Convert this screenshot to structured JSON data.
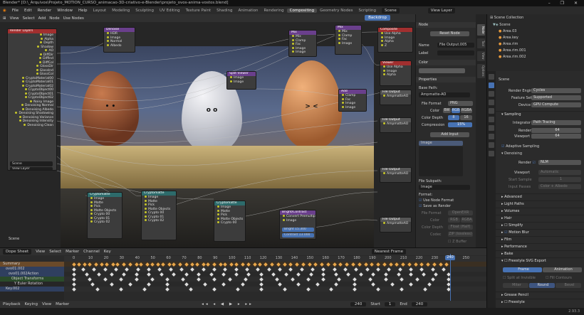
{
  "window": {
    "title": "Blender* [D:\\_Arquivos\\Projeto_MOTION_CURSO_animacao-3D-criativo-e-Blender\\projeto_ovos-anima-vostos.blend]",
    "controls": "– ❐ ✕"
  },
  "menubar": {
    "items": [
      "File",
      "Edit",
      "Render",
      "Window",
      "Help"
    ],
    "workspaces": [
      "Layout",
      "Modeling",
      "Sculpting",
      "UV Editing",
      "Texture Paint",
      "Shading",
      "Animation",
      "Rendering",
      "Compositing",
      "Geometry Nodes",
      "Scripting"
    ],
    "active_workspace": "Compositing",
    "scene": "Scene",
    "view_layer": "View Layer"
  },
  "node_editor": {
    "header": [
      "View",
      "Select",
      "Add",
      "Node",
      "Use Nodes"
    ],
    "backdrop_label": "Backdrop",
    "faces": [
      "• •",
      "o o",
      "> <"
    ],
    "nodes": {
      "render_layers": {
        "title": "Render Layers",
        "sockets": [
          "Image",
          "Alpha",
          "Depth",
          "Shadow",
          "AO",
          "DiffDir",
          "DiffInd",
          "DiffCol",
          "GlossDir",
          "GlossInd",
          "GlossCol",
          "CryptoMaterial00",
          "CryptoMaterial01",
          "CryptoMaterial02",
          "CryptoObject00",
          "CryptoObject01",
          "CryptoObject02",
          "Noisy Image",
          "Denoising Normal",
          "Denoising Albedo",
          "Denoising Shadowing",
          "Denoising Variance",
          "Denoising Intensity",
          "Denoising Clean"
        ],
        "scene": "Scene",
        "layer": "View Layer"
      },
      "denoise": {
        "title": "Denoise",
        "sockets": [
          "HDR",
          "Image",
          "Normal",
          "Albedo"
        ]
      },
      "composite": {
        "title": "Composite",
        "sockets": [
          "Use Alpha",
          "Image",
          "Alpha",
          "Z"
        ]
      },
      "viewer": {
        "title": "Viewer",
        "sockets": [
          "Use Alpha",
          "Image",
          "Alpha",
          "Z"
        ]
      },
      "mix1": {
        "title": "Mix",
        "sockets": [
          "Mix",
          "Clamp",
          "Fac",
          "Image",
          "Image"
        ]
      },
      "mix2": {
        "title": "Mix",
        "sockets": [
          "Mix",
          "Clamp",
          "Fac",
          "Image",
          "Image"
        ]
      },
      "split": {
        "title": "Split Viewer",
        "sockets": [
          "Image",
          "Image"
        ]
      },
      "add": {
        "title": "Add",
        "sockets": [
          "Clamp",
          "Fac",
          "Image",
          "Image"
        ]
      },
      "file_output_1": {
        "title": "File Output",
        "sockets": [
          "Image",
          "AmpmatteAO"
        ]
      },
      "file_output_2": {
        "title": "File Output",
        "sockets": [
          "Image",
          "AmpmatteAO"
        ]
      },
      "file_output_3": {
        "title": "File Output",
        "sockets": [
          "Image",
          "AmpmatteAO"
        ]
      },
      "file_output_4": {
        "title": "File Output",
        "sockets": [
          "Image",
          "AmpmatteAO"
        ]
      },
      "crypto1": {
        "title": "Cryptomatte",
        "sockets": [
          "Image",
          "Matte",
          "Pick",
          "Matte Objects",
          "Crypto 00",
          "Crypto 01",
          "Crypto 02"
        ]
      },
      "crypto2": {
        "title": "Cryptomatte",
        "sockets": [
          "Image",
          "Matte",
          "Pick",
          "Matte Objects",
          "Crypto 00",
          "Crypto 01",
          "Crypto 02"
        ]
      },
      "crypto3": {
        "title": "Cryptomatte",
        "sockets": [
          "Image",
          "Matte",
          "Pick",
          "Matte Objects",
          "Crypto 00",
          "Crypto 01"
        ]
      },
      "bright": {
        "title": "Bright/Contrast",
        "sockets": [
          "Image",
          "Bright",
          "Contrast"
        ],
        "bright": "15.300",
        "contrast": "13.000"
      },
      "convert": {
        "title": "Convert Premultiplied"
      }
    }
  },
  "npanel": {
    "tabs": [
      "Node",
      "Tool",
      "View",
      "Options"
    ],
    "node_section": "Node",
    "reset_node": "Reset Node",
    "name_label": "Name",
    "name_value": "File Output.005",
    "label_label": "Label",
    "color_section": "Color",
    "properties_section": "Properties",
    "base_path_label": "Base Path:",
    "base_path_value": "Ampmatte-AO",
    "file_format_label": "File Format",
    "file_format_value": "PNG",
    "color_label": "Color",
    "color_opts": [
      "BW",
      "RGB",
      "RGBA"
    ],
    "color_depth_label": "Color Depth",
    "color_depth_opts": [
      "8",
      "16"
    ],
    "compression_label": "Compression",
    "compression_value": "15%",
    "add_input": "Add Input",
    "input_item": "Image",
    "file_subpath_label": "File Subpath:",
    "file_subpath_value": "Image",
    "format_label": "Format:",
    "use_node_format": "Use Node Format",
    "save_as_render": "Save as Render",
    "file_format2_label": "File Format",
    "file_format2_value": "OpenEXR",
    "color2_label": "Color",
    "color2_opts": [
      "RGB",
      "RGBA"
    ],
    "color_depth2_label": "Color Depth",
    "color_depth2_value": "Float (Half)",
    "codec_label": "Codec",
    "codec_value": "ZIP (lossless)",
    "zbuffer": "Z Buffer"
  },
  "outliner": {
    "header": "Scene Collection",
    "rows": [
      "Scene",
      "Area.03",
      "Area.key",
      "Area.rim",
      "Area.rim.001",
      "Area.rim.002"
    ]
  },
  "properties": {
    "scene_label": "Scene",
    "render_engine_label": "Render Engine",
    "render_engine_value": "Cycles",
    "feature_set_label": "Feature Set",
    "feature_set_value": "Supported",
    "device_label": "Device",
    "device_value": "GPU Compute",
    "sampling_section": "Sampling",
    "integrator_label": "Integrator",
    "integrator_value": "Path Tracing",
    "render_label": "Render",
    "render_value": "64",
    "viewport_label": "Viewport",
    "viewport_value": "64",
    "adaptive_sampling": "Adaptive Sampling",
    "denoising": "Denoising",
    "denoise_render_label": "Render",
    "denoise_render_value": "NLM",
    "denoise_viewport_label": "Viewport",
    "denoise_viewport_value": "Automatic",
    "start_sample_label": "Start Sample",
    "start_sample_value": "1",
    "input_passes_label": "Input Passes",
    "input_passes_value": "Color + Albedo",
    "sections": [
      "Advanced",
      "Light Paths",
      "Volumes",
      "Hair",
      "Simplify",
      "Motion Blur",
      "Film",
      "Performance",
      "Bake",
      "Freestyle SVG Export"
    ],
    "frame_tab": "Frame",
    "animation_tab": "Animation",
    "split_at_invisible": "Split at Invisible",
    "fill_contours": "Fill Contours",
    "miter": "Miter",
    "round": "Round",
    "bevel": "Bevel",
    "grease_pencil": "Grease Pencil",
    "freestyle": "Freestyle"
  },
  "dopesheet": {
    "mode": "Dope Sheet",
    "menus": [
      "View",
      "Select",
      "Marker",
      "Channel",
      "Key"
    ],
    "snap": "Nearest Frame",
    "ruler": [
      "0",
      "10",
      "20",
      "30",
      "40",
      "50",
      "60",
      "70",
      "80",
      "90",
      "100",
      "110",
      "120",
      "130",
      "140",
      "150",
      "160",
      "170",
      "180",
      "190",
      "200",
      "210",
      "220",
      "230",
      "240",
      "250"
    ],
    "channels": [
      "Summary",
      "ovo01.002",
      "ovo01.002Action",
      "Object Transforms",
      "Y Euler Rotation",
      "Key.002"
    ],
    "current_frame": "240"
  },
  "timeline": {
    "menus": [
      "Playback",
      "Keying",
      "View",
      "Marker"
    ],
    "frame": "240",
    "start_label": "Start",
    "start": "1",
    "end_label": "End",
    "end": "240"
  },
  "statusbar": {
    "version": "2.93.3"
  },
  "colors": {
    "accent": "#4772b3",
    "node_red": "#a12f2f",
    "keyframe": "#dddddd"
  }
}
